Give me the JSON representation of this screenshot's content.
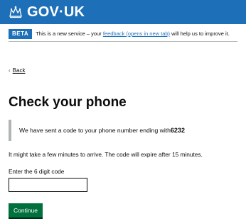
{
  "header": {
    "logo_text": "GOV·UK",
    "logo_icon": "crown-icon"
  },
  "phase_banner": {
    "tag": "BETA",
    "text_before": "This is a new service – your ",
    "link": "feedback (opens in new tab)",
    "text_after": " will help us to improve it."
  },
  "back_link": {
    "chevron": "‹",
    "label": "Back"
  },
  "page": {
    "title": "Check your phone",
    "inset_text": "We have sent a code to your phone number ending with ",
    "phone_ending": "6232",
    "hint": "It might take a few minutes to arrive. The code will expire after 15 minutes.",
    "code_label": "Enter the 6 digit code",
    "code_value": "",
    "continue_label": "Continue"
  },
  "colors": {
    "header_blue": "#1d70b8",
    "button_green": "#00703c",
    "link_blue": "#1d70b8",
    "inset_border": "#b1b4b6"
  }
}
